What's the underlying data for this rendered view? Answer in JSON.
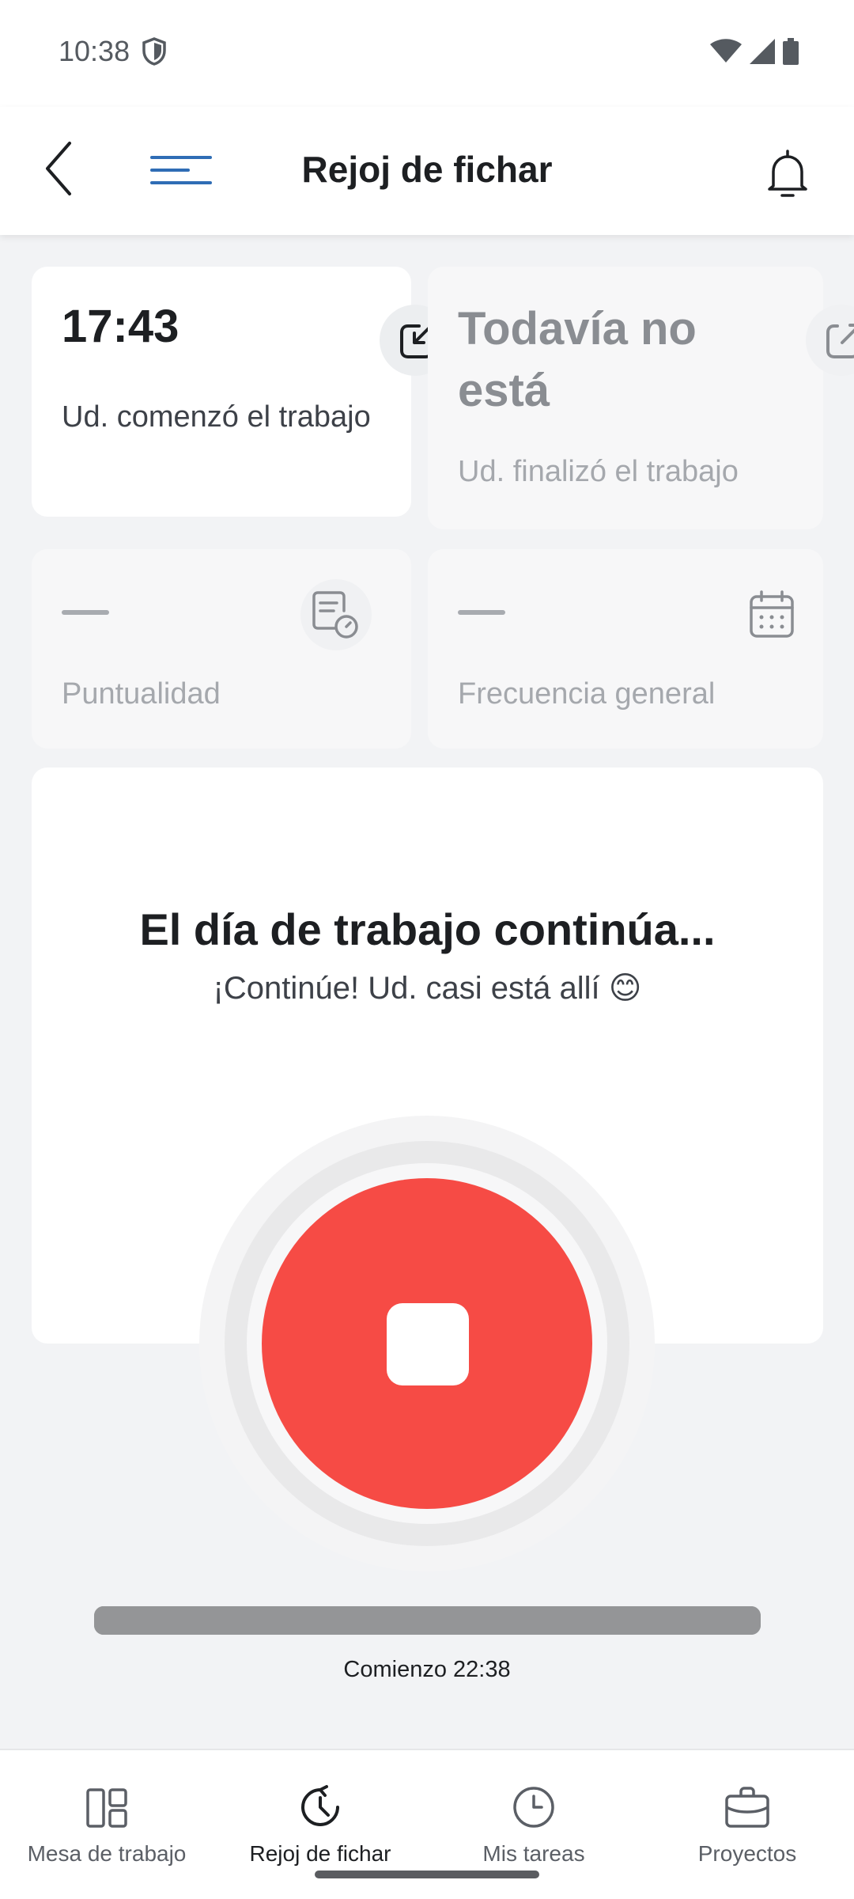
{
  "status_bar": {
    "time": "10:38",
    "icons": [
      "shield-icon",
      "wifi-icon",
      "signal-icon",
      "battery-icon"
    ]
  },
  "header": {
    "title": "Rejoj de fichar",
    "icons": [
      "back-arrow-icon",
      "menu-icon",
      "bell-icon"
    ]
  },
  "start_card": {
    "time": "17:43",
    "label": "Ud. comenzó el trabajo",
    "icon": "clock-in-arrow-icon"
  },
  "end_card": {
    "value": "Todavía no está",
    "label": "Ud. finalizó el trabajo",
    "icon": "external-link-icon"
  },
  "punctuality_card": {
    "value": "—",
    "label": "Puntualidad",
    "icon": "document-clock-icon"
  },
  "frequency_card": {
    "value": "—",
    "label": "Frecuencia general",
    "icon": "calendar-icon"
  },
  "workday": {
    "title": "El día de trabajo continúa...",
    "subtitle": "¡Continúe! Ud. casi está allí 😊",
    "stop_button_icon": "stop-icon",
    "stop_button_color": "#f64b45",
    "progress_fraction": 1.0,
    "start_caption": "Comienzo 22:38"
  },
  "bottom_nav": {
    "items": [
      {
        "label": "Mesa de trabajo",
        "icon": "dashboard-icon",
        "active": false
      },
      {
        "label": "Rejoj de fichar",
        "icon": "clock-arrow-icon",
        "active": true
      },
      {
        "label": "Mis tareas",
        "icon": "clock-icon",
        "active": false
      },
      {
        "label": "Proyectos",
        "icon": "briefcase-icon",
        "active": false
      }
    ]
  },
  "colors": {
    "accent": "#2f6db5",
    "stop": "#f64b45",
    "background": "#f2f3f5"
  }
}
